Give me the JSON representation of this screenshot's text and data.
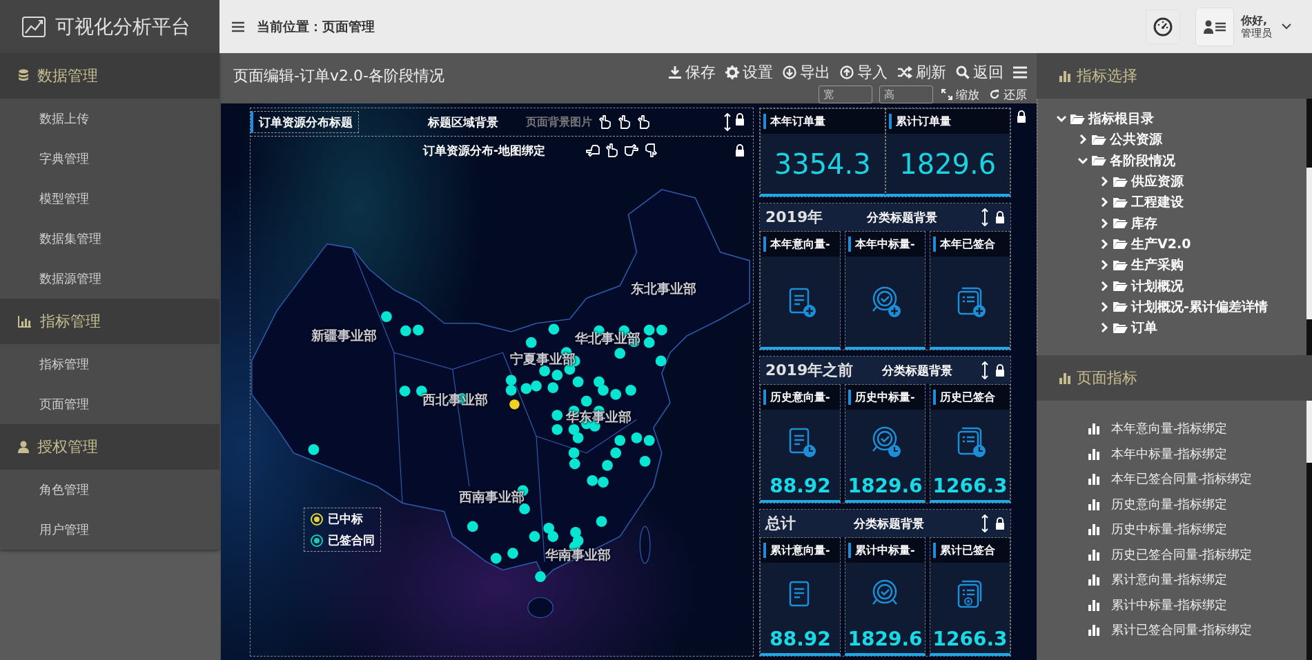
{
  "sidebar": {
    "logo": "可视化分析平台",
    "sections": [
      {
        "title": "数据管理",
        "items": [
          "数据上传",
          "字典管理",
          "模型管理",
          "数据集管理",
          "数据源管理"
        ]
      },
      {
        "title": "指标管理",
        "items": [
          "指标管理",
          "页面管理"
        ]
      },
      {
        "title": "授权管理",
        "items": [
          "角色管理",
          "用户管理"
        ]
      }
    ]
  },
  "topbar": {
    "breadcrumb": "当前位置：页面管理",
    "greeting": "你好,",
    "user": "管理员"
  },
  "editor": {
    "title": "页面编辑-订单v2.0-各阶段情况",
    "actions": [
      "保存",
      "设置",
      "导出",
      "导入",
      "刷新",
      "返回"
    ],
    "size_fields": [
      {
        "placeholder": "宽"
      },
      {
        "placeholder": "高"
      }
    ],
    "view_actions": [
      "缩放",
      "还原"
    ]
  },
  "map": {
    "title": "订单资源分布标题",
    "title_background": "标题区域背景",
    "page_background": "页面背景图片",
    "binding": "订单资源分布-地图绑定",
    "regions": [
      "东北事业部",
      "新疆事业部",
      "华北事业部",
      "宁夏事业部",
      "西北事业部",
      "华东事业部",
      "西南事业部",
      "华南事业部"
    ],
    "legend": [
      {
        "label": "已中标",
        "color": "#e6d23a"
      },
      {
        "label": "已签合同",
        "color": "#17c9b4"
      }
    ]
  },
  "kpi_summary": [
    {
      "title": "本年订单量",
      "value": "3354.3"
    },
    {
      "title": "累计订单量",
      "value": "1829.6"
    }
  ],
  "kpi_groups": [
    {
      "title": "2019年",
      "background": "分类标题背景",
      "cards": [
        {
          "title": "本年意向量-",
          "kind": "document-plus"
        },
        {
          "title": "本年中标量-",
          "kind": "seal-plus"
        },
        {
          "title": "本年已签合",
          "kind": "stack-plus"
        }
      ]
    },
    {
      "title": "2019年之前",
      "background": "分类标题背景",
      "cards": [
        {
          "title": "历史意向量-",
          "kind": "document-clock",
          "value": "88.92"
        },
        {
          "title": "历史中标量-",
          "kind": "seal-clock",
          "value": "1829.6"
        },
        {
          "title": "历史已签合",
          "kind": "stack-clock",
          "value": "1266.3"
        }
      ]
    },
    {
      "title": "总计",
      "background": "分类标题背景",
      "cards": [
        {
          "title": "累计意向量-",
          "kind": "document",
          "value": "88.92"
        },
        {
          "title": "累计中标量-",
          "kind": "seal",
          "value": "1829.6"
        },
        {
          "title": "累计已签合",
          "kind": "stack-star",
          "value": "1266.3"
        }
      ]
    }
  ],
  "right_panel": {
    "tree_title": "指标选择",
    "tree": [
      {
        "label": "指标根目录",
        "expanded": true,
        "children": [
          {
            "label": "公共资源",
            "expanded": false
          },
          {
            "label": "各阶段情况",
            "expanded": true,
            "children": [
              {
                "label": "供应资源",
                "expanded": false
              },
              {
                "label": "工程建设",
                "expanded": false
              },
              {
                "label": "库存",
                "expanded": false
              },
              {
                "label": "生产V2.0",
                "expanded": false
              },
              {
                "label": "生产采购",
                "expanded": false
              },
              {
                "label": "计划概况",
                "expanded": false
              },
              {
                "label": "计划概况-累计偏差详情",
                "expanded": false
              },
              {
                "label": "订单",
                "expanded": false
              }
            ]
          }
        ]
      }
    ],
    "indicators_title": "页面指标",
    "indicators": [
      "本年意向量-指标绑定",
      "本年中标量-指标绑定",
      "本年已签合同量-指标绑定",
      "历史意向量-指标绑定",
      "历史中标量-指标绑定",
      "历史已签合同量-指标绑定",
      "累计意向量-指标绑定",
      "累计中标量-指标绑定",
      "累计已签合同量-指标绑定"
    ]
  }
}
